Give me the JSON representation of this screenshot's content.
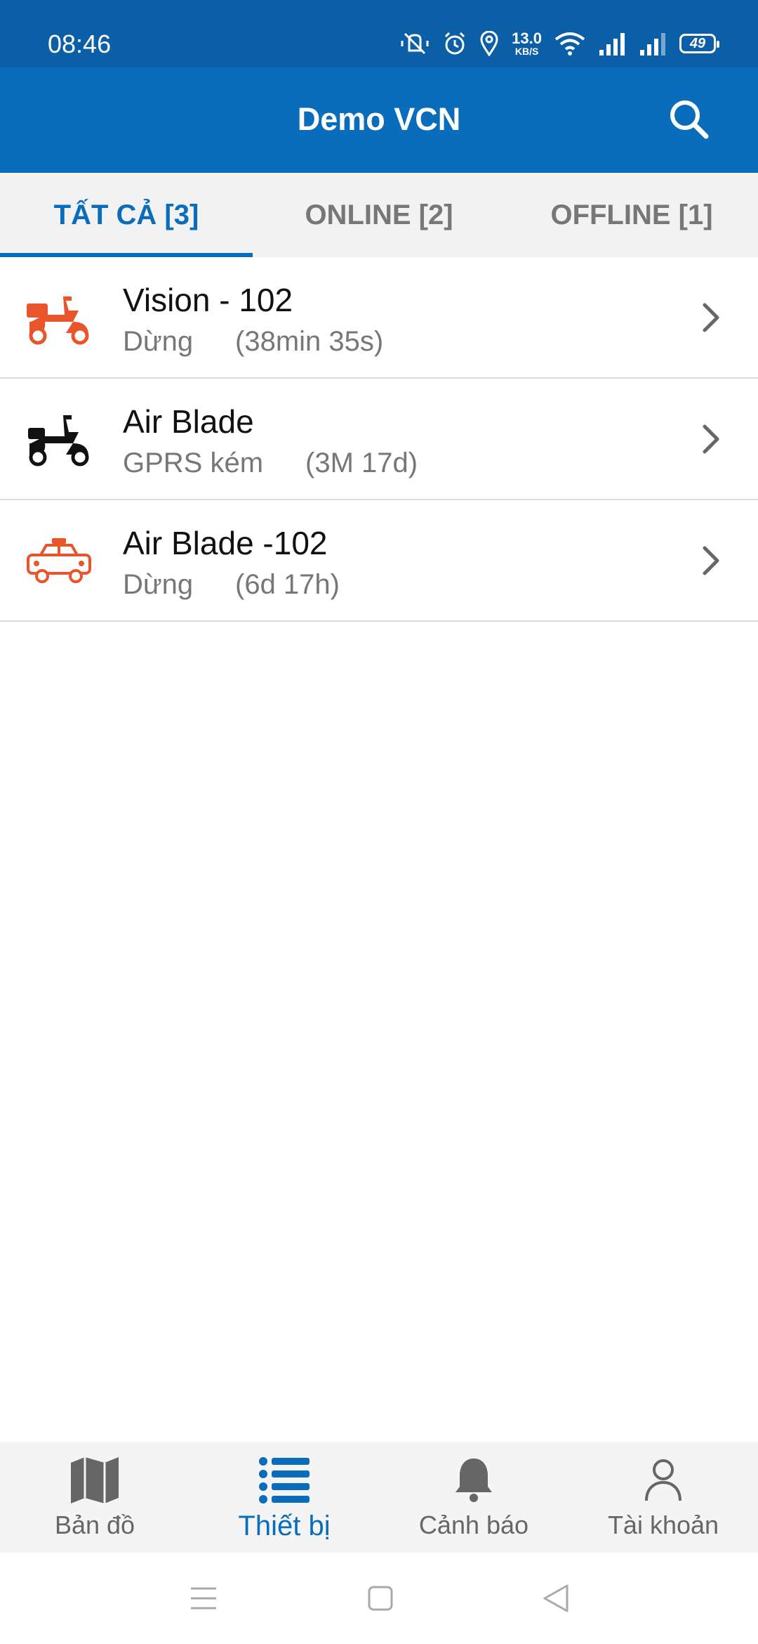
{
  "status_bar": {
    "time": "08:46",
    "net_speed_value": "13.0",
    "net_speed_unit": "KB/S",
    "battery": "49",
    "icons": [
      "vibrate-off-icon",
      "alarm-icon",
      "location-icon",
      "wifi-icon",
      "signal-1-icon",
      "signal-2-icon"
    ]
  },
  "app_bar": {
    "title": "Demo VCN",
    "search_icon": "search-icon"
  },
  "tabs": [
    {
      "label": "TẤT CẢ [3]",
      "active": true
    },
    {
      "label": "ONLINE [2]",
      "active": false
    },
    {
      "label": "OFFLINE [1]",
      "active": false
    }
  ],
  "devices": [
    {
      "name": "Vision - 102",
      "state": "Dừng",
      "duration": "(38min 35s)",
      "icon": "delivery-scooter-icon",
      "icon_color": "#e8552b"
    },
    {
      "name": "Air Blade",
      "state": "GPRS kém",
      "duration": "(3M 17d)",
      "icon": "scooter-icon",
      "icon_color": "#111111"
    },
    {
      "name": "Air Blade -102",
      "state": "Dừng",
      "duration": "(6d 17h)",
      "icon": "taxi-icon",
      "icon_color": "#e8552b"
    }
  ],
  "bottom_nav": [
    {
      "label": "Bản đồ",
      "icon": "map-icon",
      "active": false
    },
    {
      "label": "Thiết bị",
      "icon": "list-icon",
      "active": true
    },
    {
      "label": "Cảnh báo",
      "icon": "bell-icon",
      "active": false
    },
    {
      "label": "Tài khoản",
      "icon": "user-icon",
      "active": false
    }
  ],
  "colors": {
    "primary": "#0a6dbb",
    "status_bar": "#0a5fa6",
    "accent_orange": "#e8552b",
    "muted_text": "#777777"
  }
}
